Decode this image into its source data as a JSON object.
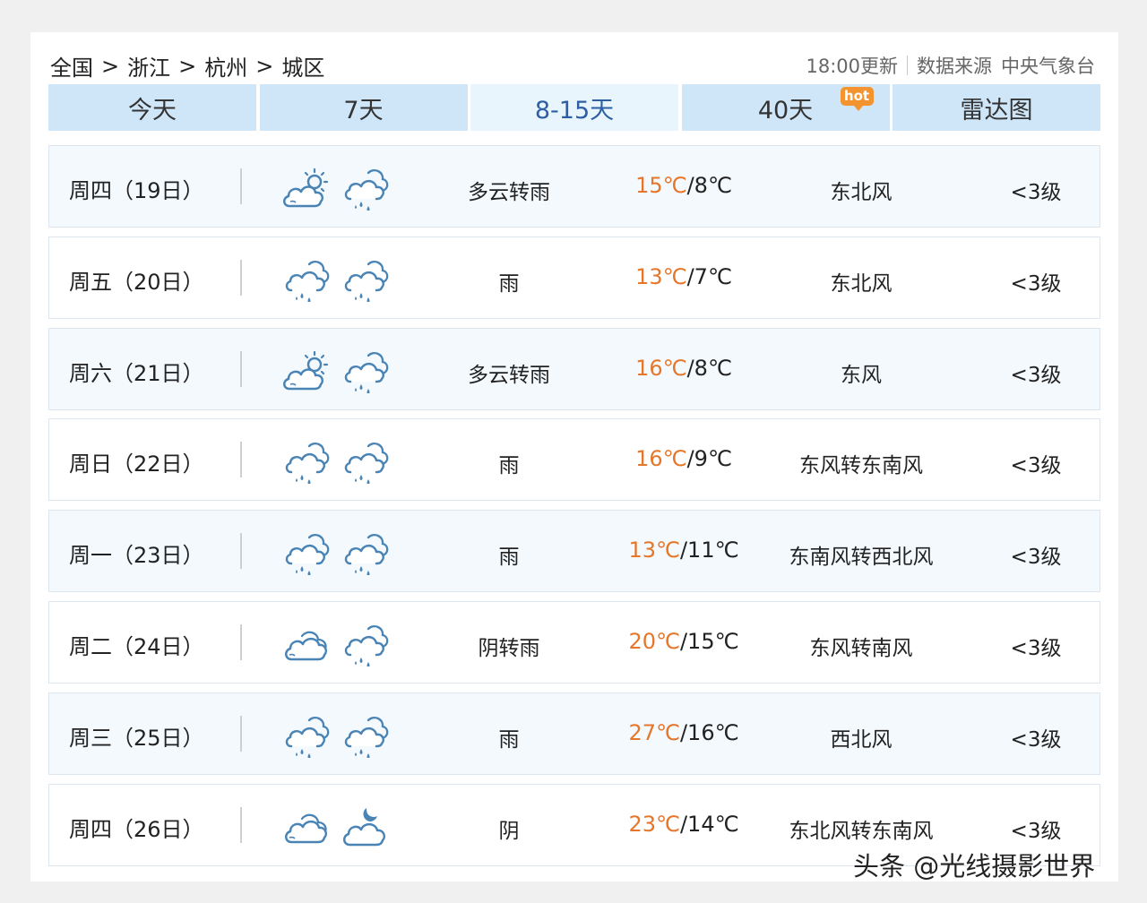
{
  "breadcrumb": [
    "全国",
    "浙江",
    "杭州",
    "城区"
  ],
  "breadcrumb_separator": ">",
  "meta": {
    "updated": "18:00更新",
    "source_label": "数据来源",
    "source": "中央气象台"
  },
  "tabs": [
    {
      "label": "今天",
      "active": false
    },
    {
      "label": "7天",
      "active": false
    },
    {
      "label": "8-15天",
      "active": true
    },
    {
      "label": "40天",
      "active": false,
      "badge": "hot"
    },
    {
      "label": "雷达图",
      "active": false
    }
  ],
  "temp_unit": "℃",
  "forecast": [
    {
      "day": "周四（19日）",
      "icons": [
        "partly-cloudy-icon",
        "rain-icon"
      ],
      "condition": "多云转雨",
      "high": "15",
      "low": "8",
      "wind": "东北风",
      "level": "<3级"
    },
    {
      "day": "周五（20日）",
      "icons": [
        "rain-icon",
        "rain-icon"
      ],
      "condition": "雨",
      "high": "13",
      "low": "7",
      "wind": "东北风",
      "level": "<3级"
    },
    {
      "day": "周六（21日）",
      "icons": [
        "partly-cloudy-icon",
        "rain-icon"
      ],
      "condition": "多云转雨",
      "high": "16",
      "low": "8",
      "wind": "东风",
      "level": "<3级"
    },
    {
      "day": "周日（22日）",
      "icons": [
        "rain-icon",
        "rain-icon"
      ],
      "condition": "雨",
      "high": "16",
      "low": "9",
      "wind": "东风转东南风",
      "level": "<3级"
    },
    {
      "day": "周一（23日）",
      "icons": [
        "rain-icon",
        "rain-icon"
      ],
      "condition": "雨",
      "high": "13",
      "low": "11",
      "wind": "东南风转西北风",
      "level": "<3级"
    },
    {
      "day": "周二（24日）",
      "icons": [
        "overcast-icon",
        "rain-icon"
      ],
      "condition": "阴转雨",
      "high": "20",
      "low": "15",
      "wind": "东风转南风",
      "level": "<3级"
    },
    {
      "day": "周三（25日）",
      "icons": [
        "rain-icon",
        "rain-icon"
      ],
      "condition": "雨",
      "high": "27",
      "low": "16",
      "wind": "西北风",
      "level": "<3级"
    },
    {
      "day": "周四（26日）",
      "icons": [
        "overcast-icon",
        "cloudy-night-icon"
      ],
      "condition": "阴",
      "high": "23",
      "low": "14",
      "wind": "东北风转东南风",
      "level": "<3级"
    }
  ],
  "watermark": "头条 @光线摄影世界",
  "colors": {
    "tab_bg": "#cfe6f8",
    "tab_active_bg": "#e9f5fd",
    "tab_active_text": "#2e5ea3",
    "hot_badge": "#f49431",
    "temp_high": "#e5762a",
    "icon_stroke": "#4a84b5",
    "row_alt_bg": "#f3f9fd"
  }
}
